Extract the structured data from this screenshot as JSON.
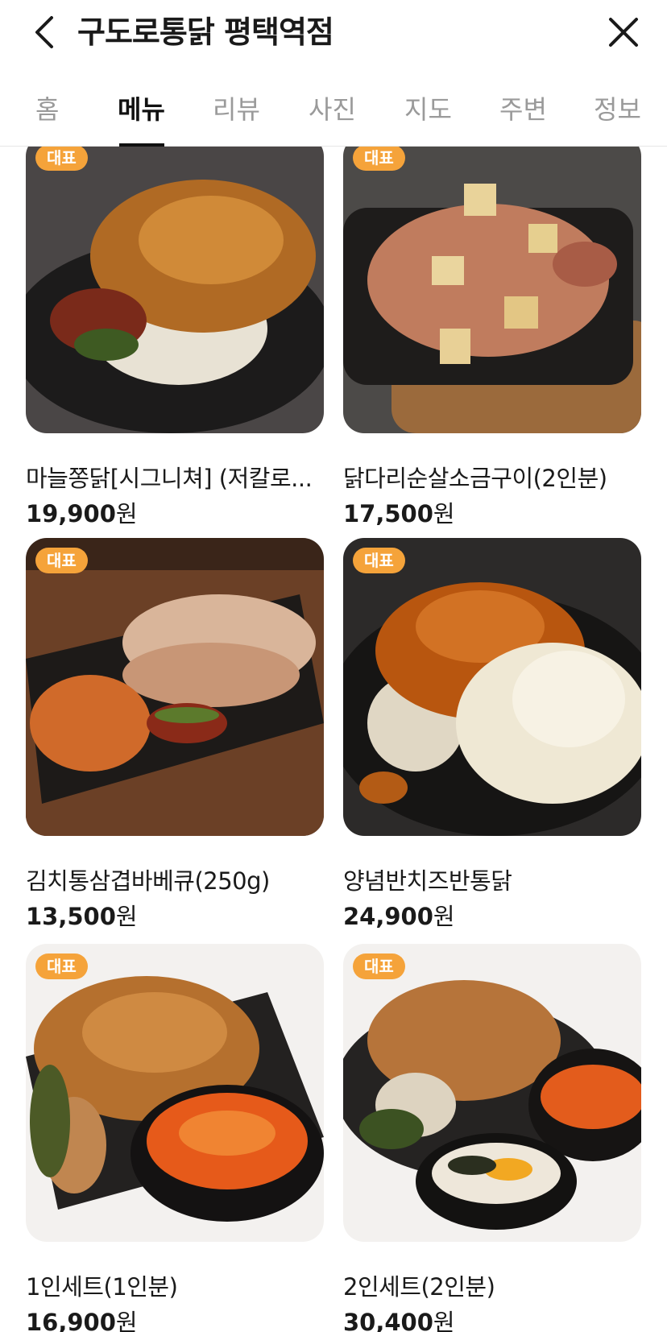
{
  "header": {
    "title": "구도로통닭 평택역점",
    "back_icon": "chevron-left-icon",
    "close_icon": "close-icon"
  },
  "tabs": [
    {
      "label": "홈",
      "active": false
    },
    {
      "label": "메뉴",
      "active": true
    },
    {
      "label": "리뷰",
      "active": false
    },
    {
      "label": "사진",
      "active": false
    },
    {
      "label": "지도",
      "active": false
    },
    {
      "label": "주변",
      "active": false
    },
    {
      "label": "정보",
      "active": false
    }
  ],
  "colors": {
    "badge": "#f5a33a",
    "active_tab": "#111111",
    "inactive_tab": "#9a9a9a"
  },
  "menu": [
    {
      "badge": "대표",
      "name": "마늘쫑닭[시그니쳐] (저칼로...",
      "price": "19,900",
      "unit": "원"
    },
    {
      "badge": "대표",
      "name": "닭다리순살소금구이(2인분)",
      "price": "17,500",
      "unit": "원"
    },
    {
      "badge": "대표",
      "name": "김치통삼겹바베큐(250g)",
      "price": "13,500",
      "unit": "원"
    },
    {
      "badge": "대표",
      "name": "양념반치즈반통닭",
      "price": "24,900",
      "unit": "원"
    },
    {
      "badge": "대표",
      "name": "1인세트(1인분)",
      "price": "16,900",
      "unit": "원"
    },
    {
      "badge": "대표",
      "name": "2인세트(2인분)",
      "price": "30,400",
      "unit": "원"
    }
  ]
}
